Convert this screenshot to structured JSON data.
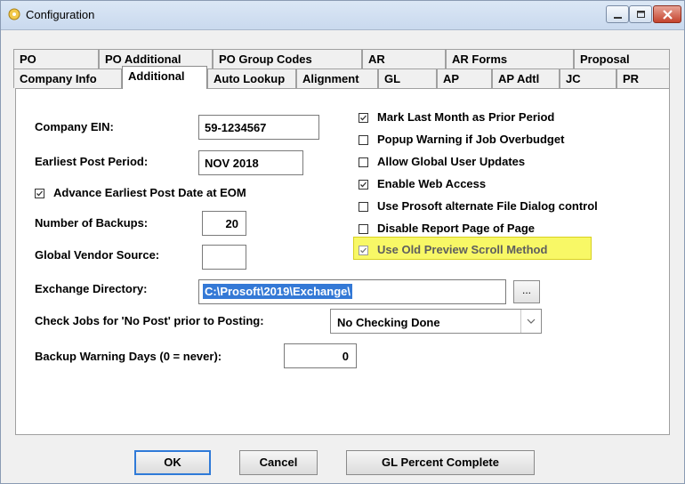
{
  "window": {
    "title": "Configuration"
  },
  "tabs_row1": [
    "PO",
    "PO Additional",
    "PO Group Codes",
    "AR",
    "AR Forms",
    "Proposal"
  ],
  "tabs_row2": [
    "Company Info",
    "Additional",
    "Auto Lookup",
    "Alignment",
    "GL",
    "AP",
    "AP Adtl",
    "JC",
    "PR"
  ],
  "active_tab": "Additional",
  "fields": {
    "company_ein": {
      "label": "Company EIN:",
      "value": "59-1234567"
    },
    "earliest_post": {
      "label": "Earliest Post Period:",
      "value": "NOV 2018"
    },
    "num_backups": {
      "label": "Number of Backups:",
      "value": "20"
    },
    "vendor_source": {
      "label": "Global Vendor Source:",
      "value": ""
    },
    "exchange_dir": {
      "label": "Exchange Directory:",
      "value": "C:\\Prosoft\\2019\\Exchange\\"
    },
    "check_jobs": {
      "label": "Check Jobs for 'No Post' prior to Posting:",
      "value": "No Checking Done"
    },
    "backup_warning": {
      "label": "Backup Warning Days (0 = never):",
      "value": "0"
    }
  },
  "checkboxes": {
    "advance_eom": {
      "label": "Advance Earliest Post Date at EOM",
      "checked": true
    },
    "mark_last_month": {
      "label": "Mark Last Month as Prior Period",
      "checked": true
    },
    "popup_warning": {
      "label": "Popup Warning if Job Overbudget",
      "checked": false
    },
    "allow_global": {
      "label": "Allow Global User Updates",
      "checked": false
    },
    "enable_web": {
      "label": "Enable Web Access",
      "checked": true
    },
    "alt_file_dialog": {
      "label": "Use Prosoft alternate File Dialog control",
      "checked": false
    },
    "disable_report": {
      "label": "Disable Report Page of Page",
      "checked": false
    },
    "old_preview": {
      "label": "Use Old Preview Scroll Method",
      "checked": true
    }
  },
  "browse_label": "...",
  "buttons": {
    "ok": "OK",
    "cancel": "Cancel",
    "gl_percent": "GL Percent Complete"
  },
  "colors": {
    "highlight": "#f8f866",
    "selection": "#3479d6",
    "close_button": "#c4432d"
  }
}
